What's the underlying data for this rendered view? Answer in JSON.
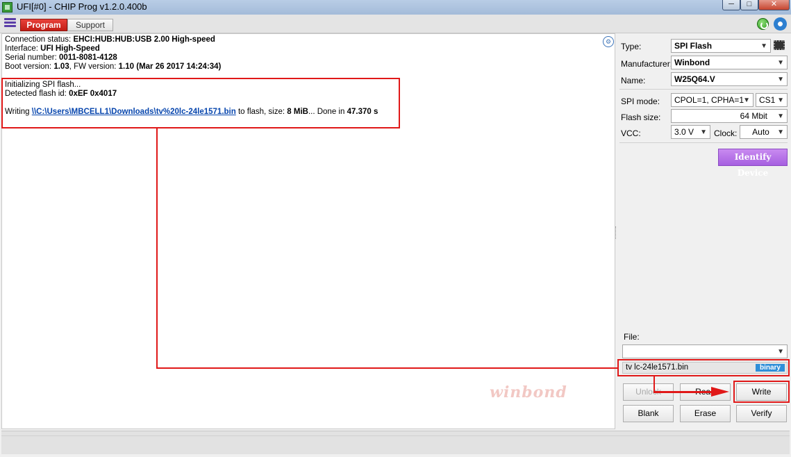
{
  "window": {
    "title": "UFI[#0] - CHIP Prog v1.2.0.400b",
    "minimize": "─",
    "maximize": "□",
    "close": "✕"
  },
  "toolbar": {
    "tab_program": "Program",
    "tab_support": "Support"
  },
  "log": {
    "connection_label": "Connection status: ",
    "connection_value": "EHCI:HUB:HUB:USB 2.00 High-speed",
    "interface_label": "Interface: ",
    "interface_value": "UFI High-Speed",
    "serial_label": "Serial number: ",
    "serial_value": "0011-8081-4128",
    "boot_label": " Boot version: ",
    "boot_value": "1.03",
    "fw_label": ", FW version: ",
    "fw_value": "1.10 (Mar 26 2017 14:24:34)",
    "init_line": "Initializing SPI flash...",
    "detected_label": "Detected flash id: ",
    "detected_value": "0xEF 0x4017",
    "writing_prefix": "Writing ",
    "writing_path": "\\\\C:\\Users\\MBCELL1\\Downloads\\tv%20lc-24le1571.bin",
    "writing_mid": " to flash, size: ",
    "writing_size": "8 MiB",
    "writing_done": "... Done in ",
    "writing_time": "47.370 s",
    "watermark": "winbond"
  },
  "device": {
    "type_label": "Type:",
    "type_value": "SPI Flash",
    "manufacturer_label": "Manufacturer:",
    "manufacturer_value": "Winbond",
    "name_label": "Name:",
    "name_value": "W25Q64.V",
    "spi_mode_label": "SPI mode:",
    "spi_mode_value": "CPOL=1, CPHA=1",
    "cs_value": "CS1",
    "flash_size_label": "Flash size:",
    "flash_size_value": "64 Mbit",
    "vcc_label": "VCC:",
    "vcc_value": "3.0 V",
    "clock_label": "Clock:",
    "clock_value": "Auto",
    "identify_button": "Identify Device"
  },
  "file": {
    "label": "File:",
    "combo_value": "",
    "filename": "tv lc-24le1571.bin",
    "format_badge": "binary"
  },
  "actions": {
    "unlock": "Unlock",
    "read": "Read",
    "write": "Write",
    "blank": "Blank",
    "erase": "Erase",
    "verify": "Verify"
  },
  "colors": {
    "program_tab": "#d12a22",
    "identify_button": "#b06ee6",
    "annotation_red": "#e01818",
    "badge_blue": "#2f8fd9"
  }
}
